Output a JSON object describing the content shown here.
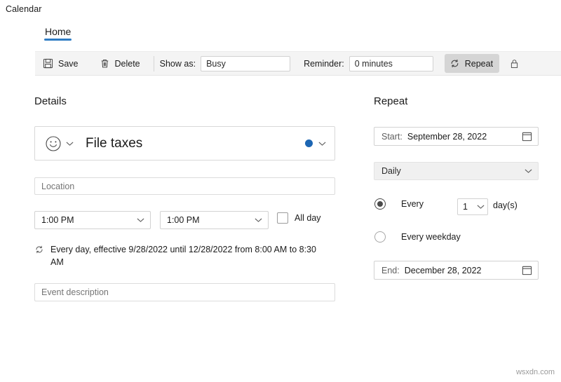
{
  "window": {
    "title": "Calendar"
  },
  "ribbon": {
    "tabs": [
      {
        "label": "Home",
        "selected": true
      }
    ],
    "accent_color": "#2f7cc4"
  },
  "toolbar": {
    "save_label": "Save",
    "save_icon": "save-floppy-icon",
    "delete_label": "Delete",
    "delete_icon": "trash-icon",
    "show_as_label": "Show as:",
    "show_as_value": "Busy",
    "reminder_label": "Reminder:",
    "reminder_value": "0 minutes",
    "repeat_label": "Repeat",
    "repeat_icon": "repeat-icon",
    "repeat_toggled": true,
    "private_icon": "lock-icon"
  },
  "details": {
    "heading": "Details",
    "emoji_icon": "smiley-face-icon",
    "emoji_chevron_icon": "chevron-down-icon",
    "subject_value": "File taxes",
    "color_dot_icon": "calendar-color-dot-icon",
    "color_dot_hex": "#1d66b3",
    "color_chevron_icon": "chevron-down-icon",
    "location_placeholder": "Location",
    "start_time_value": "1:00 PM",
    "end_time_value": "1:00 PM",
    "all_day_label": "All day",
    "all_day_checked": false,
    "recurrence_icon": "repeat-icon",
    "recurrence_summary": "Every day, effective 9/28/2022 until 12/28/2022 from 8:00 AM to 8:30 AM",
    "description_placeholder": "Event description"
  },
  "repeat": {
    "heading": "Repeat",
    "start_label": "Start:",
    "start_value": "September 28, 2022",
    "start_calendar_icon": "calendar-icon",
    "frequency_value": "Daily",
    "frequency_chevron_icon": "chevron-down-icon",
    "every_label": "Every",
    "every_selected": true,
    "interval_value": "1",
    "interval_unit_label": "day(s)",
    "interval_chevron_icon": "chevron-down-icon",
    "every_weekday_label": "Every weekday",
    "every_weekday_selected": false,
    "end_label": "End:",
    "end_value": "December 28, 2022",
    "end_calendar_icon": "calendar-icon"
  },
  "watermark": {
    "text": "wsxdn.com"
  }
}
